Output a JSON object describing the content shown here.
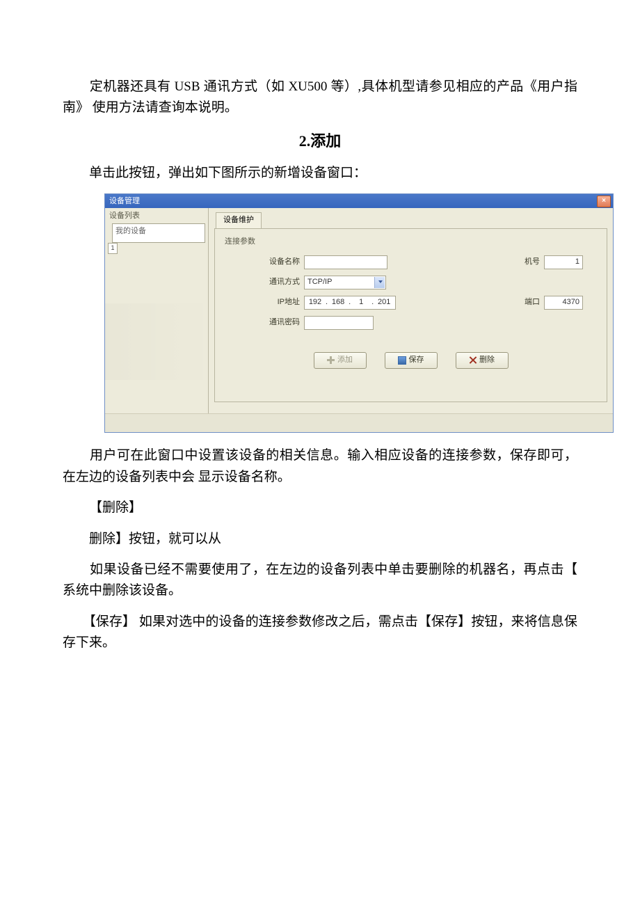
{
  "doc": {
    "p1": "定机器还具有 USB 通讯方式（如 XU500 等）,具体机型请参见相应的产品《用户指南》 使用方法请查询本说明。",
    "h2": "2.添加",
    "p2": "单击此按钮，弹出如下图所示的新增设备窗口：",
    "p3": "用户可在此窗口中设置该设备的相关信息。输入相应设备的连接参数，保存即可，在左边的设备列表中会 显示设备名称。",
    "p4": "【删除】",
    "p5": "删除】按钮，就可以从",
    "p6": "如果设备已经不需要使用了，在左边的设备列表中单击要删除的机器名，再点击【 系统中删除该设备。",
    "p7": "【保存】 如果对选中的设备的连接参数修改之后，需点击【保存】按钮，来将信息保存下来。"
  },
  "win": {
    "title": "设备管理",
    "close": "×",
    "sidebar": {
      "group": "设备列表",
      "root": "我的设备",
      "num": "1"
    },
    "tab": "设备维护",
    "group": "连接参数",
    "labels": {
      "name": "设备名称",
      "mode": "通讯方式",
      "ip": "IP地址",
      "pwd": "通讯密码",
      "machine": "机号",
      "port": "端口"
    },
    "values": {
      "mode": "TCP/IP",
      "ip": [
        "192",
        "168",
        "1",
        "201"
      ],
      "machine": "1",
      "port": "4370"
    },
    "buttons": {
      "add": "添加",
      "save": "保存",
      "del": "删除"
    }
  }
}
